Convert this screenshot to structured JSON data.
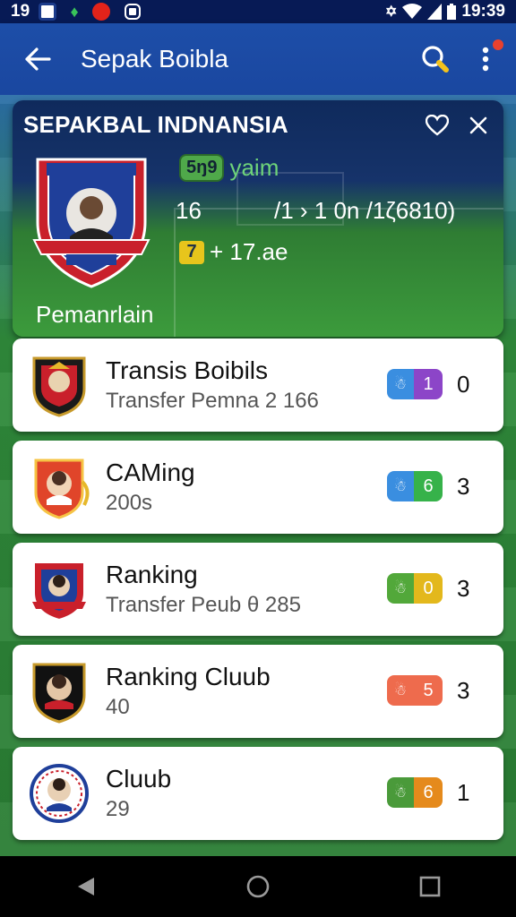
{
  "status_bar": {
    "time_left": "19",
    "time_right": "19:39"
  },
  "app_bar": {
    "title": "Sepak Boibla"
  },
  "hero": {
    "title": "SEPAKBAL INDNANSIA",
    "tag_pill": "5ŋ9",
    "tag_text": "yaim",
    "line2_left": "16",
    "line2_right": "/1 › 1 0n /1ζ6810)",
    "badge": "7",
    "line3": "+ 17.ae",
    "subtitle": "Pemanrlain"
  },
  "rows": [
    {
      "title": "Transis Boibils",
      "subtitle": "Transfer Pemnа 2 166",
      "badge_num": "1",
      "badge_icon": "☃",
      "value": "0",
      "colors": [
        "#3a8ee0",
        "#8c45c8"
      ],
      "logo": "badge-dark"
    },
    {
      "title": "CAMing",
      "subtitle": "200s",
      "badge_num": "6",
      "badge_icon": "☃",
      "value": "3",
      "colors": [
        "#3a8ee0",
        "#36b24a"
      ],
      "logo": "badge-red"
    },
    {
      "title": "Ranking",
      "subtitle": "Transfer Peub θ 285",
      "badge_num": "0",
      "badge_icon": "☃",
      "value": "3",
      "colors": [
        "#52a83a",
        "#e3b81c"
      ],
      "logo": "badge-blue"
    },
    {
      "title": "Ranking Cluub",
      "subtitle": "40",
      "badge_num": "5",
      "badge_icon": "☃",
      "value": "3",
      "colors": [
        "#ee6b4d",
        "#ee6b4d"
      ],
      "logo": "badge-black"
    },
    {
      "title": "Cluub",
      "subtitle": "29",
      "badge_num": "6",
      "badge_icon": "☃",
      "value": "1",
      "colors": [
        "#4a9a3a",
        "#e58a1c"
      ],
      "logo": "badge-white"
    }
  ]
}
